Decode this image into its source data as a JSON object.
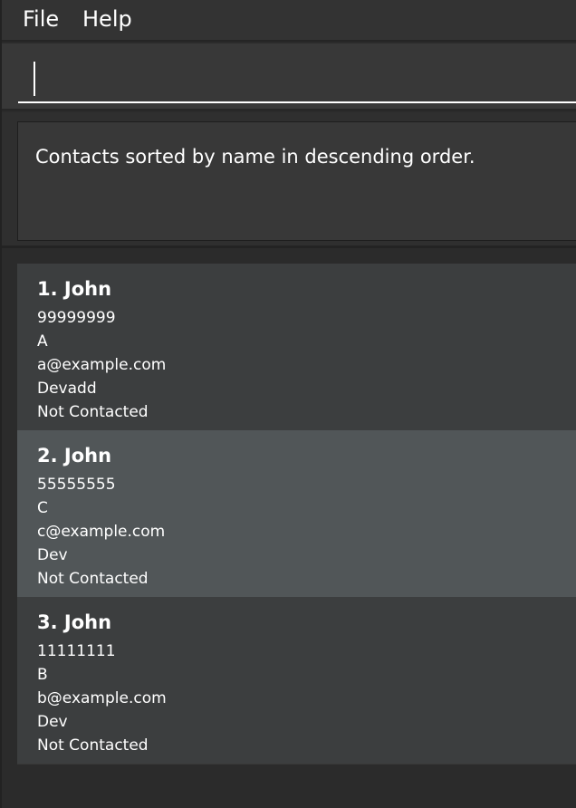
{
  "menu": {
    "file_label": "File",
    "help_label": "Help"
  },
  "command_box": {
    "value": "",
    "placeholder": ""
  },
  "result_display": {
    "message": "Contacts sorted by name in descending order."
  },
  "contacts": [
    {
      "index_name": "1. John",
      "phone": "99999999",
      "address": "A",
      "email": "a@example.com",
      "role": "Devadd",
      "status": "Not Contacted",
      "selected": false
    },
    {
      "index_name": "2. John",
      "phone": "55555555",
      "address": "C",
      "email": "c@example.com",
      "role": "Dev",
      "status": "Not Contacted",
      "selected": true
    },
    {
      "index_name": "3. John",
      "phone": "11111111",
      "address": "B",
      "email": "b@example.com",
      "role": "Dev",
      "status": "Not Contacted",
      "selected": false
    }
  ]
}
